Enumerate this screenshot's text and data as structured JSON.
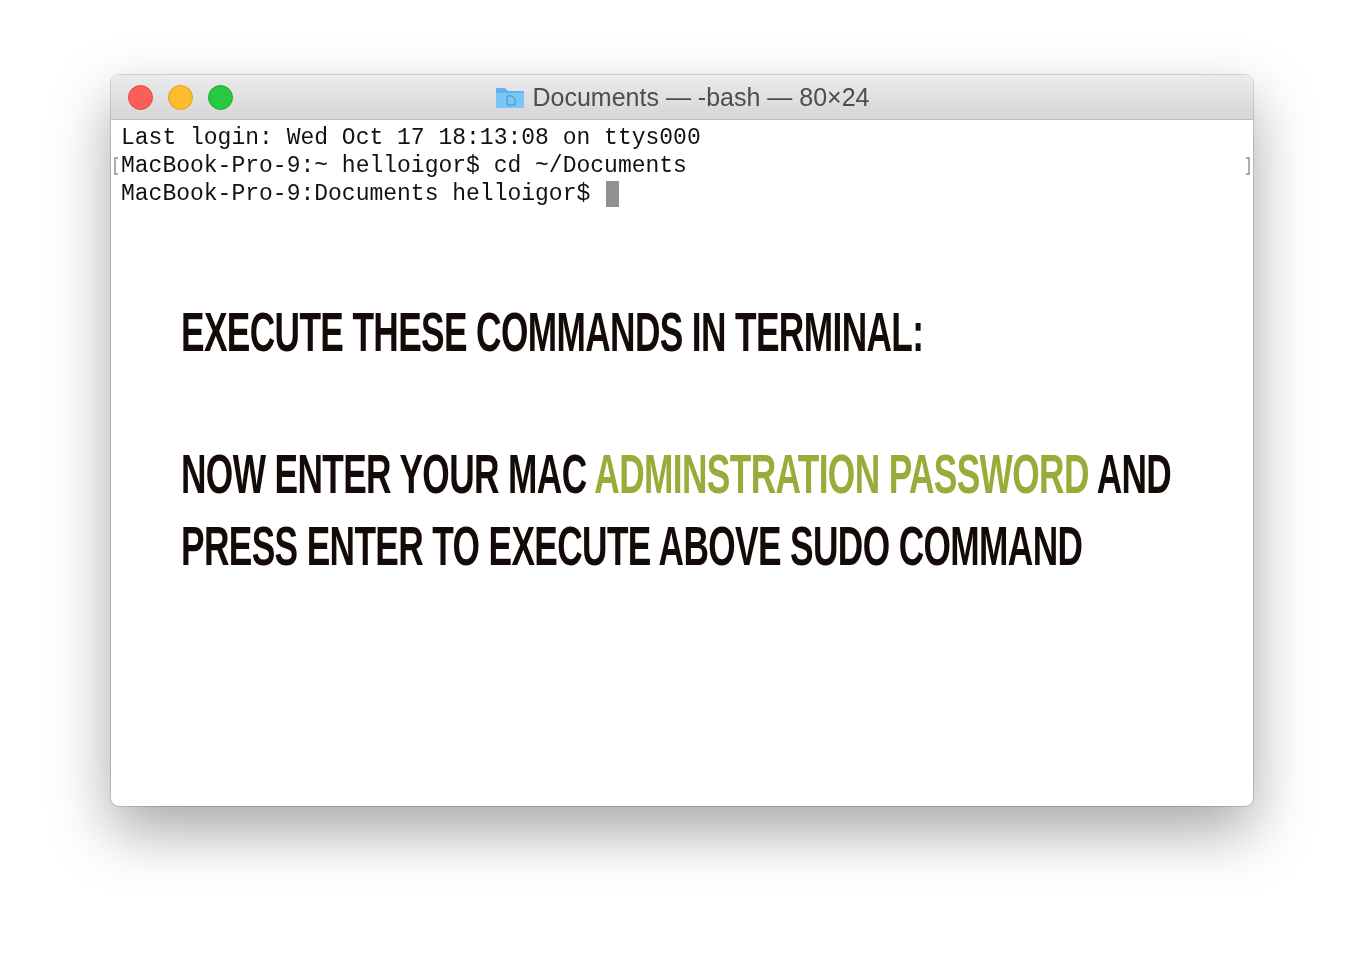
{
  "window": {
    "title": "Documents — -bash — 80×24"
  },
  "terminal": {
    "lines": [
      {
        "text": "Last login: Wed Oct 17 18:13:08 on ttys000",
        "marked": false,
        "cursor": false
      },
      {
        "text": "MacBook-Pro-9:~ helloigor$ cd ~/Documents",
        "marked": true,
        "cursor": false
      },
      {
        "text": "MacBook-Pro-9:Documents helloigor$ ",
        "marked": false,
        "cursor": true
      }
    ]
  },
  "overlay": {
    "heading": "EXECUTE THESE COMMANDS IN TERMINAL:",
    "instruction": [
      {
        "text": "NOW ENTER YOUR MAC ",
        "highlight": false
      },
      {
        "text": "ADMINSTRATION PASSWORD",
        "highlight": true
      },
      {
        "text": " AND PRESS ENTER TO EXECUTE ABOVE SUDO COMMAND",
        "highlight": false
      }
    ]
  }
}
